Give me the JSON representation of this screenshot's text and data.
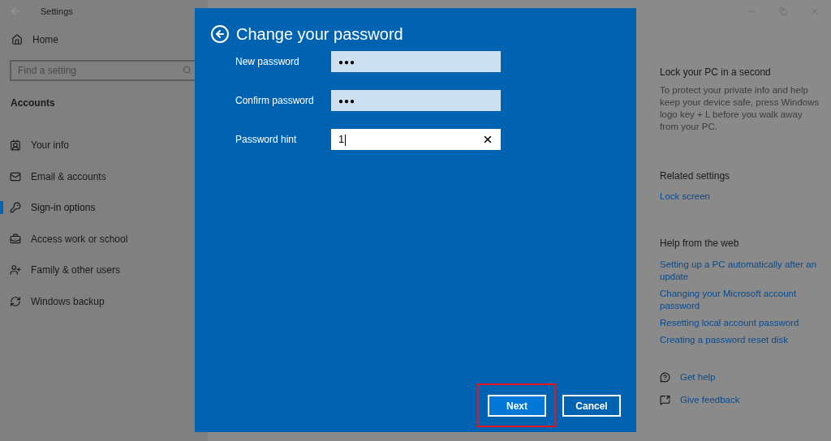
{
  "window": {
    "title": "Settings"
  },
  "sidebar": {
    "home": "Home",
    "search": {
      "placeholder": "Find a setting"
    },
    "section": "Accounts",
    "items": [
      {
        "label": "Your info",
        "selected": false
      },
      {
        "label": "Email & accounts",
        "selected": false
      },
      {
        "label": "Sign-in options",
        "selected": true
      },
      {
        "label": "Access work or school",
        "selected": false
      },
      {
        "label": "Family & other users",
        "selected": false
      },
      {
        "label": "Windows backup",
        "selected": false
      }
    ]
  },
  "aside": {
    "lock_title": "Lock your PC in a second",
    "lock_text": "To protect your private info and help keep your device safe, press Windows logo key + L before you walk away from your PC.",
    "related_title": "Related settings",
    "related_links": [
      "Lock screen"
    ],
    "help_title": "Help from the web",
    "help_links": [
      "Setting up a PC automatically after an update",
      "Changing your Microsoft account password",
      "Resetting local account password",
      "Creating a password reset disk"
    ],
    "actions": [
      {
        "label": "Get help"
      },
      {
        "label": "Give feedback"
      }
    ]
  },
  "dialog": {
    "title": "Change your password",
    "fields": [
      {
        "label": "New password",
        "kind": "password",
        "value": "●●●",
        "focused": false
      },
      {
        "label": "Confirm password",
        "kind": "password",
        "value": "●●●",
        "focused": false
      },
      {
        "label": "Password hint",
        "kind": "text",
        "value": "1",
        "focused": true
      }
    ],
    "buttons": [
      {
        "label": "Next",
        "primary": true,
        "highlighted": true
      },
      {
        "label": "Cancel",
        "primary": false,
        "highlighted": false
      }
    ]
  }
}
